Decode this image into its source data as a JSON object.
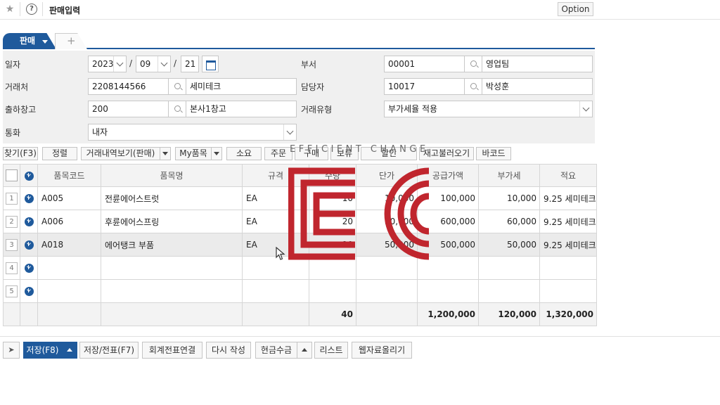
{
  "header": {
    "title": "판매입력",
    "option_label": "Option"
  },
  "tabs": {
    "active_label": "판매",
    "add_label": "+"
  },
  "form": {
    "date_label": "일자",
    "date_year": "2023",
    "date_month": "09",
    "date_day": "21",
    "date_sep": "/",
    "dept_label": "부서",
    "dept_code": "00001",
    "dept_name": "영업팀",
    "client_label": "거래처",
    "client_code": "2208144566",
    "client_name": "세미테크",
    "manager_label": "담당자",
    "manager_code": "10017",
    "manager_name": "박성훈",
    "warehouse_label": "출하창고",
    "warehouse_code": "200",
    "warehouse_name": "본사1창고",
    "trade_type_label": "거래유형",
    "trade_type_value": "부가세율 적용",
    "currency_label": "통화",
    "currency_value": "내자"
  },
  "toolbar": {
    "find": "찾기(F3)",
    "sort": "정렬",
    "history": "거래내역보기(판매)",
    "my_items": "My품목",
    "consume": "소요",
    "order": "주문",
    "purchase": "구매",
    "keep": "보류",
    "discount": "할인",
    "stock_load": "재고불러오기",
    "barcode": "바코드"
  },
  "grid": {
    "columns": [
      "품목코드",
      "품목명",
      "규격",
      "수량",
      "단가",
      "공급가액",
      "부가세",
      "적요"
    ],
    "rows": [
      {
        "no": "1",
        "code": "A005",
        "name": "전륜에어스트럿",
        "spec": "EA",
        "qty": "10",
        "price": "10,000",
        "supply": "100,000",
        "vat": "10,000",
        "memo": "9.25 세미테크"
      },
      {
        "no": "2",
        "code": "A006",
        "name": "후륜에어스프링",
        "spec": "EA",
        "qty": "20",
        "price": "30,000",
        "supply": "600,000",
        "vat": "60,000",
        "memo": "9.25 세미테크"
      },
      {
        "no": "3",
        "code": "A018",
        "name": "에어탱크 부품",
        "spec": "EA",
        "qty": "10",
        "price": "50,000",
        "supply": "500,000",
        "vat": "50,000",
        "memo": "9.25 세미테크"
      },
      {
        "no": "4",
        "code": "",
        "name": "",
        "spec": "",
        "qty": "",
        "price": "",
        "supply": "",
        "vat": "",
        "memo": ""
      },
      {
        "no": "5",
        "code": "",
        "name": "",
        "spec": "",
        "qty": "",
        "price": "",
        "supply": "",
        "vat": "",
        "memo": ""
      }
    ],
    "totals": {
      "qty": "40",
      "supply": "1,200,000",
      "vat": "120,000",
      "total": "1,320,000"
    }
  },
  "bottom": {
    "save": "저장(F8)",
    "save_slip": "저장/전표(F7)",
    "accounting_link": "회계전표연결",
    "rewrite": "다시 작성",
    "cash_receipt": "현금수금",
    "list": "리스트",
    "web_upload": "웹자료올리기"
  },
  "watermark": {
    "text": "EFFICIENT CHANGE",
    "color": "#c0262e"
  },
  "colors": {
    "accent": "#1f5a9c",
    "form_bg": "#f0f0f0"
  }
}
